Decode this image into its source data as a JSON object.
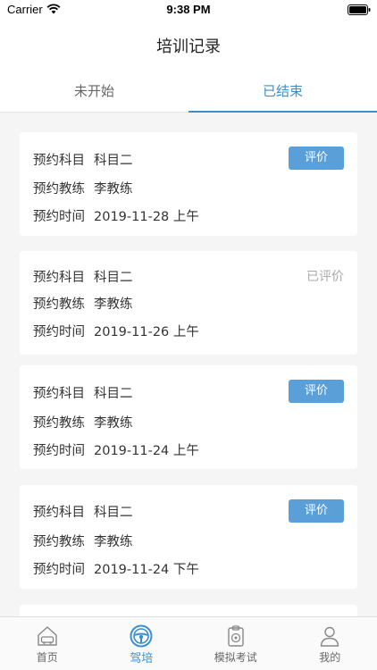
{
  "status_bar": {
    "carrier": "Carrier",
    "time": "9:38 PM"
  },
  "nav": {
    "title": "培训记录"
  },
  "tabs": [
    {
      "label": "未开始",
      "active": false
    },
    {
      "label": "已结束",
      "active": true
    }
  ],
  "labels": {
    "subject": "预约科目",
    "coach": "预约教练",
    "time": "预约时间"
  },
  "records": [
    {
      "subject": "科目二",
      "coach": "李教练",
      "time": "2019-11-28 上午",
      "action": "评价",
      "reviewed": false
    },
    {
      "subject": "科目二",
      "coach": "李教练",
      "time": "2019-11-26 上午",
      "action": "已评价",
      "reviewed": true
    },
    {
      "subject": "科目二",
      "coach": "李教练",
      "time": "2019-11-24 上午",
      "action": "评价",
      "reviewed": false
    },
    {
      "subject": "科目二",
      "coach": "李教练",
      "time": "2019-11-24 下午",
      "action": "评价",
      "reviewed": false
    }
  ],
  "tab_bar": [
    {
      "label": "首页",
      "icon": "home-icon",
      "active": false
    },
    {
      "label": "驾培",
      "icon": "steering-wheel-icon",
      "active": true
    },
    {
      "label": "模拟考试",
      "icon": "exam-clipboard-icon",
      "active": false
    },
    {
      "label": "我的",
      "icon": "profile-icon",
      "active": false
    }
  ],
  "colors": {
    "accent": "#3b8fd0",
    "button": "#5a9fd8",
    "background": "#f5f5f5"
  }
}
